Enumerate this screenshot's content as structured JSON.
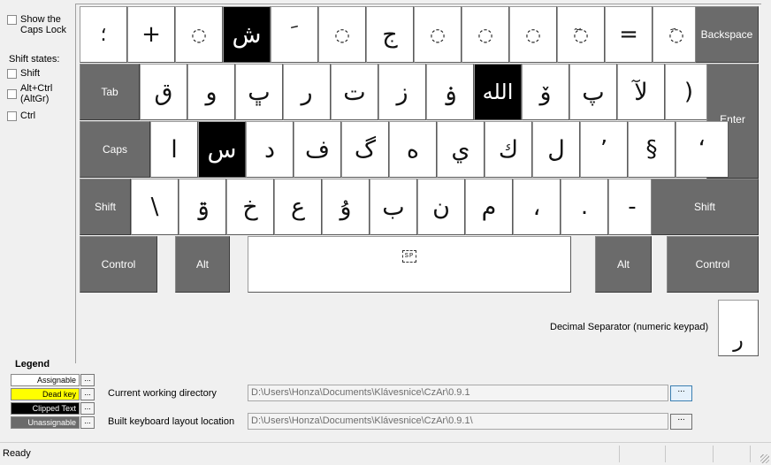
{
  "left_panel": {
    "show_caps_label": "Show the Caps Lock",
    "shift_states_title": "Shift states:",
    "shift_label": "Shift",
    "altgr_label": "Alt+Ctrl (AltGr)",
    "ctrl_label": "Ctrl"
  },
  "keyboard": {
    "row1": [
      "؛",
      "+",
      "◌",
      "ش",
      "ﹶ",
      "◌",
      "ج",
      "◌",
      "◌",
      "◌",
      "◌ٓ",
      "=",
      "◌َ"
    ],
    "backspace": "Backspace",
    "tab": "Tab",
    "row2": [
      "ق",
      "و",
      "ڀ",
      "ر",
      "ت",
      "ز",
      "ۏ",
      "الله",
      "ۆ",
      "پ",
      "لآ",
      ")"
    ],
    "enter": "Enter",
    "caps": "Caps",
    "row3": [
      "ا",
      "س",
      "د",
      "ف",
      "گ",
      "ه",
      "ي",
      "ك",
      "ل",
      "’",
      "§",
      "‘"
    ],
    "shift_left": "Shift",
    "row4": [
      "\\",
      "ۊ",
      "خ",
      "ع",
      "ۇ",
      "ب",
      "ن",
      "م",
      "،",
      ".",
      "-"
    ],
    "shift_right": "Shift",
    "control_left": "Control",
    "alt_left": "Alt",
    "space_label": "SP",
    "alt_right": "Alt",
    "control_right": "Control",
    "decimal_label": "Decimal Separator (numeric keypad)",
    "decimal_key": "ﺭ"
  },
  "legend": {
    "title": "Legend",
    "items": [
      {
        "label": "Assignable",
        "color": "#ffffff"
      },
      {
        "label": "Dead key",
        "color": "#ffff00"
      },
      {
        "label": "Clipped Text",
        "color": "#000000"
      },
      {
        "label": "Unassignable",
        "color": "#6b6b6b"
      }
    ],
    "dots": "..."
  },
  "form": {
    "cwd_label": "Current working directory",
    "cwd_value": "D:\\Users\\Honza\\Documents\\Klávesnice\\CzAr\\0.9.1",
    "build_label": "Built keyboard layout location",
    "build_value": "D:\\Users\\Honza\\Documents\\Klávesnice\\CzAr\\0.9.1\\",
    "browse": "..."
  },
  "status": {
    "text": "Ready"
  }
}
